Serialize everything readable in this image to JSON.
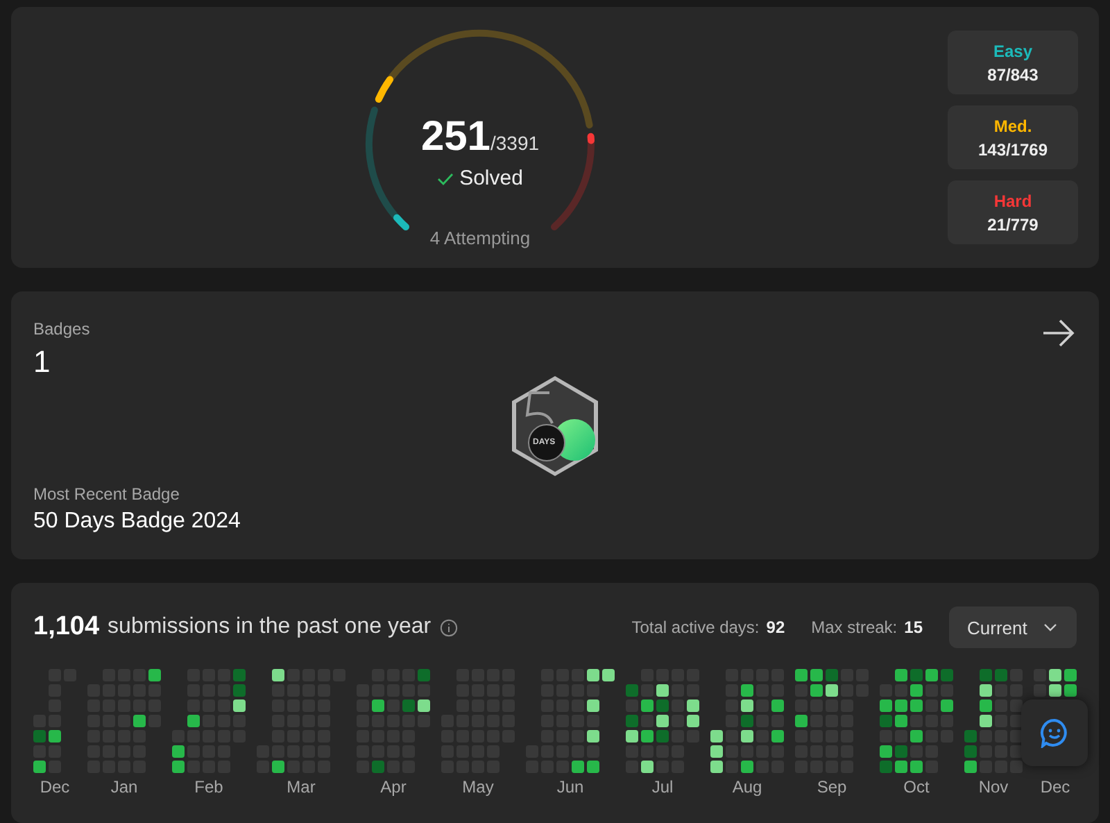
{
  "progress": {
    "solved": "251",
    "total": "/3391",
    "solved_label": "Solved",
    "attempting": "4 Attempting",
    "difficulties": [
      {
        "kind": "easy",
        "label": "Easy",
        "count": "87/843"
      },
      {
        "kind": "medium",
        "label": "Med.",
        "count": "143/1769"
      },
      {
        "kind": "hard",
        "label": "Hard",
        "count": "21/779"
      }
    ],
    "gauge_segments": [
      {
        "kind": "easy",
        "level": 0.1
      },
      {
        "kind": "medium",
        "level": 0.08
      },
      {
        "kind": "hard",
        "level": 0.03
      }
    ]
  },
  "badges": {
    "label": "Badges",
    "count": "1",
    "recent_label": "Most Recent Badge",
    "recent_name": "50 Days Badge 2024",
    "badge_text": "DAYS"
  },
  "submissions": {
    "count": "1,104",
    "caption": "submissions in the past one year",
    "active_label": "Total active days:",
    "active_value": "92",
    "streak_label": "Max streak:",
    "streak_value": "15",
    "range": "Current",
    "months": [
      {
        "label": "Dec"
      },
      {
        "label": "Jan"
      },
      {
        "label": "Feb"
      },
      {
        "label": "Mar"
      },
      {
        "label": "Apr"
      },
      {
        "label": "May"
      },
      {
        "label": "Jun"
      },
      {
        "label": "Jul"
      },
      {
        "label": "Aug"
      },
      {
        "label": "Sep"
      },
      {
        "label": "Oct"
      },
      {
        "label": "Nov"
      },
      {
        "label": "Dec"
      }
    ]
  }
}
